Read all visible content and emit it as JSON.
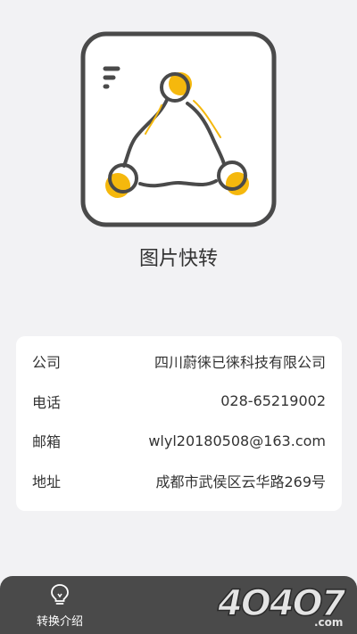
{
  "app": {
    "title": "图片快转"
  },
  "info": {
    "rows": [
      {
        "label": "公司",
        "value": "四川蔚徕已徕科技有限公司"
      },
      {
        "label": "电话",
        "value": "028-65219002"
      },
      {
        "label": "邮箱",
        "value": "wlyl20180508@163.com"
      },
      {
        "label": "地址",
        "value": "成都市武侯区云华路269号"
      }
    ]
  },
  "nav": {
    "intro_label": "转换介绍"
  },
  "watermark": {
    "text": "4O4O7",
    "sub": ".com"
  },
  "colors": {
    "accent": "#f5b80d",
    "stroke": "#4a4a4a",
    "background": "#f2f2f4",
    "nav": "#4a4a4a"
  },
  "icons": {
    "logo": "triangle-nodes-logo",
    "menu": "menu-lines-icon",
    "intro": "lightbulb-icon"
  }
}
